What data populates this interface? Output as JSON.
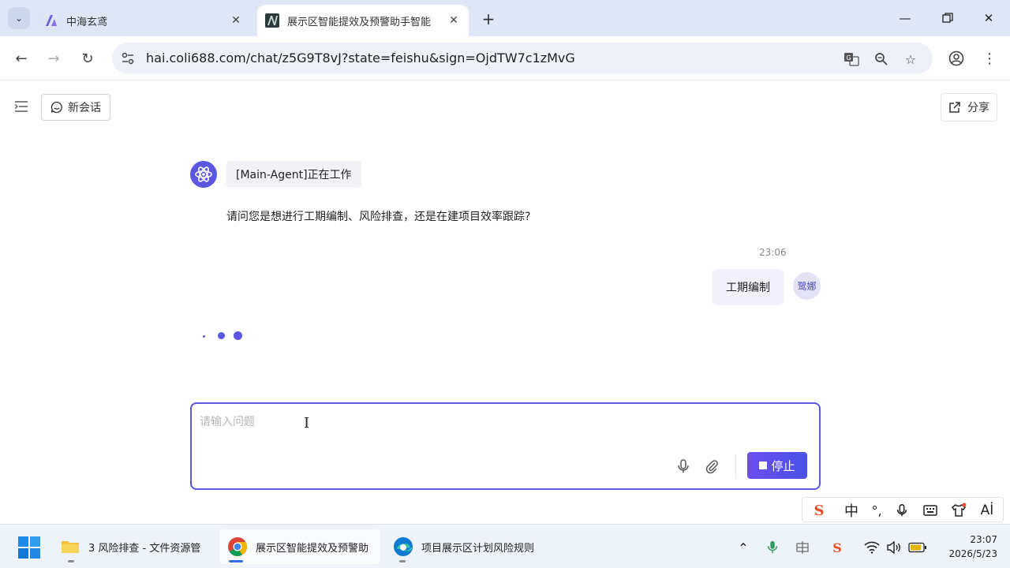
{
  "browser": {
    "tabs": [
      {
        "title": "中海玄鸢",
        "active": false
      },
      {
        "title": "展示区智能提效及预警助手智能",
        "active": true
      }
    ],
    "url": "hai.coli688.com/chat/z5G9T8vJ?state=feishu&sign=OjdTW7c1zMvG"
  },
  "header": {
    "new_chat_label": "新会话",
    "share_label": "分享"
  },
  "chat": {
    "agent_status": "[Main-Agent]正在工作",
    "bot_message": "请问您是想进行工期编制、风险排查，还是在建项目效率跟踪?",
    "user_time": "23:06",
    "user_message": "工期编制",
    "user_avatar_text": "鹭娜"
  },
  "composer": {
    "placeholder": "请输入问题",
    "stop_label": "停止"
  },
  "ime": {
    "mode_label": "中"
  },
  "taskbar": {
    "items": [
      {
        "label": "3 风险排查 - 文件资源管"
      },
      {
        "label": "展示区智能提效及预警助"
      },
      {
        "label": "项目展示区计划风险规则"
      }
    ],
    "time": "23:07",
    "date": "2026/5/23"
  },
  "colors": {
    "accent": "#5b57e0",
    "tabstrip": "#dfe7f6"
  }
}
